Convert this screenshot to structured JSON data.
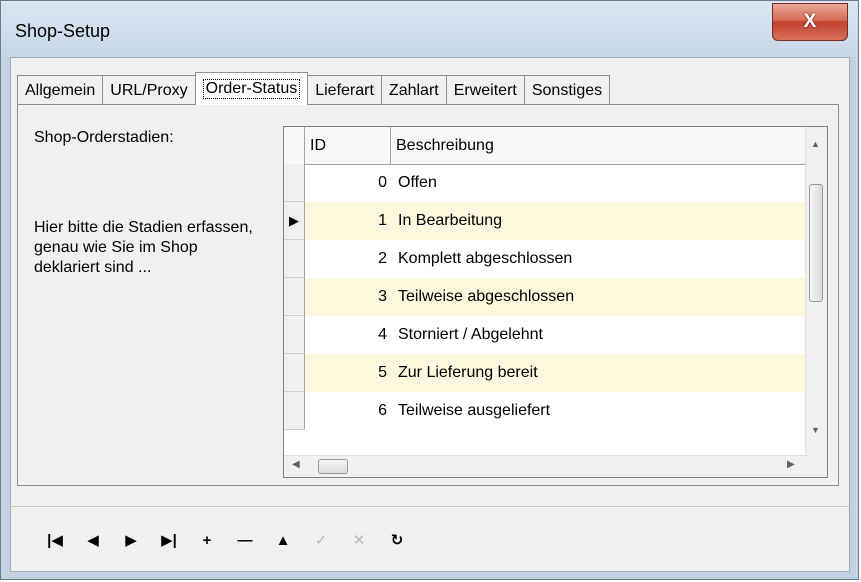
{
  "window": {
    "title": "Shop-Setup",
    "close_label": "X"
  },
  "tabs": [
    {
      "label": "Allgemein",
      "active": false
    },
    {
      "label": "URL/Proxy",
      "active": false
    },
    {
      "label": "Order-Status",
      "active": true
    },
    {
      "label": "Lieferart",
      "active": false
    },
    {
      "label": "Zahlart",
      "active": false
    },
    {
      "label": "Erweitert",
      "active": false
    },
    {
      "label": "Sonstiges",
      "active": false
    }
  ],
  "panel": {
    "label": "Shop-Orderstadien:",
    "hint": "Hier bitte die Stadien erfassen, genau wie Sie im Shop deklariert sind ..."
  },
  "grid": {
    "columns": [
      "ID",
      "Beschreibung"
    ],
    "rows": [
      {
        "id": "0",
        "desc": "Offen",
        "current": false
      },
      {
        "id": "1",
        "desc": "In Bearbeitung",
        "current": true
      },
      {
        "id": "2",
        "desc": "Komplett abgeschlossen",
        "current": false
      },
      {
        "id": "3",
        "desc": "Teilweise abgeschlossen",
        "current": false
      },
      {
        "id": "4",
        "desc": "Storniert / Abgelehnt",
        "current": false
      },
      {
        "id": "5",
        "desc": "Zur Lieferung bereit",
        "current": false
      },
      {
        "id": "6",
        "desc": "Teilweise ausgeliefert",
        "current": false
      }
    ],
    "row_indicator_glyph": "▶",
    "alt_row_color": "#fbf8dd"
  },
  "navigator": {
    "buttons": [
      {
        "name": "first-record-icon",
        "glyph": "|◀",
        "enabled": true
      },
      {
        "name": "prior-record-icon",
        "glyph": "◀",
        "enabled": true
      },
      {
        "name": "next-record-icon",
        "glyph": "▶",
        "enabled": true
      },
      {
        "name": "last-record-icon",
        "glyph": "▶|",
        "enabled": true
      },
      {
        "name": "insert-record-icon",
        "glyph": "+",
        "enabled": true
      },
      {
        "name": "delete-record-icon",
        "glyph": "—",
        "enabled": true
      },
      {
        "name": "edit-record-icon",
        "glyph": "▲",
        "enabled": true
      },
      {
        "name": "post-record-icon",
        "glyph": "✓",
        "enabled": false
      },
      {
        "name": "cancel-record-icon",
        "glyph": "✕",
        "enabled": false
      },
      {
        "name": "refresh-icon",
        "glyph": "↻",
        "enabled": true
      }
    ]
  }
}
